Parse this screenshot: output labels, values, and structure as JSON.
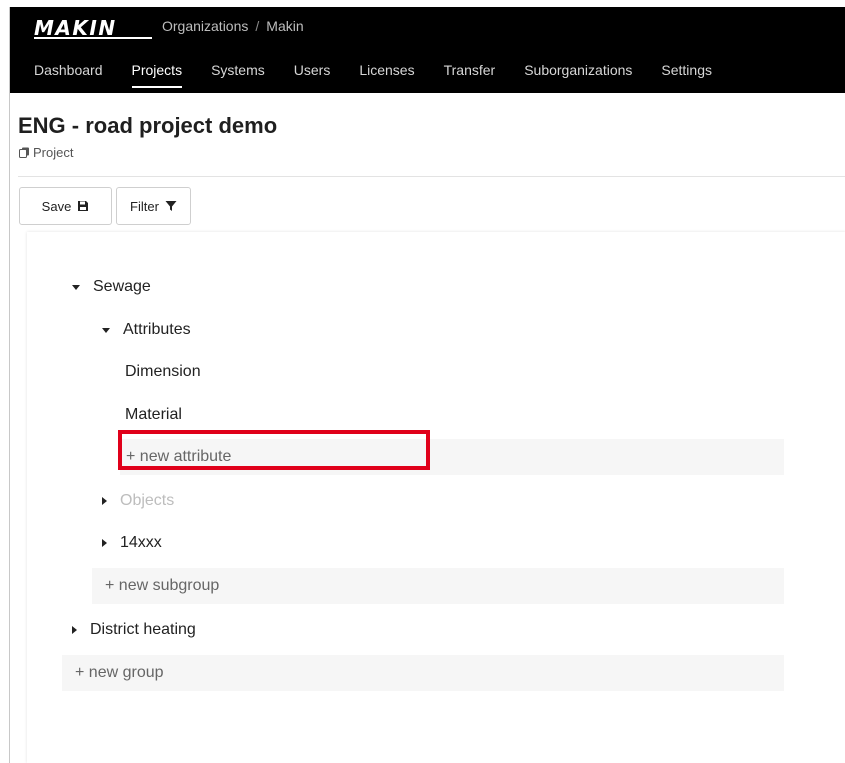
{
  "header": {
    "logo_text": "MAKIN",
    "breadcrumb": [
      "Organizations",
      "Makin"
    ],
    "breadcrumb_separator": "/"
  },
  "nav": {
    "tabs": [
      {
        "label": "Dashboard",
        "active": false
      },
      {
        "label": "Projects",
        "active": true
      },
      {
        "label": "Systems",
        "active": false
      },
      {
        "label": "Users",
        "active": false
      },
      {
        "label": "Licenses",
        "active": false
      },
      {
        "label": "Transfer",
        "active": false
      },
      {
        "label": "Suborganizations",
        "active": false
      },
      {
        "label": "Settings",
        "active": false
      }
    ]
  },
  "page": {
    "title": "ENG - road project demo",
    "subtitle": "Project",
    "subtitle_icon": "copy-icon"
  },
  "toolbar": {
    "save_label": "Save",
    "save_icon": "floppy-disk-icon",
    "filter_label": "Filter",
    "filter_icon": "funnel-icon"
  },
  "tree": {
    "group_sewage": "Sewage",
    "attributes": "Attributes",
    "attr_dimension": "Dimension",
    "attr_material": "Material",
    "new_attribute": "+ new attribute",
    "objects": "Objects",
    "subgroup_14xxx": "14xxx",
    "new_subgroup": "+ new subgroup",
    "group_district_heating": "District heating",
    "new_group": "+ new group"
  },
  "colors": {
    "topbar": "#000000",
    "highlight": "#e0001a",
    "muted": "#bdbdbd"
  }
}
